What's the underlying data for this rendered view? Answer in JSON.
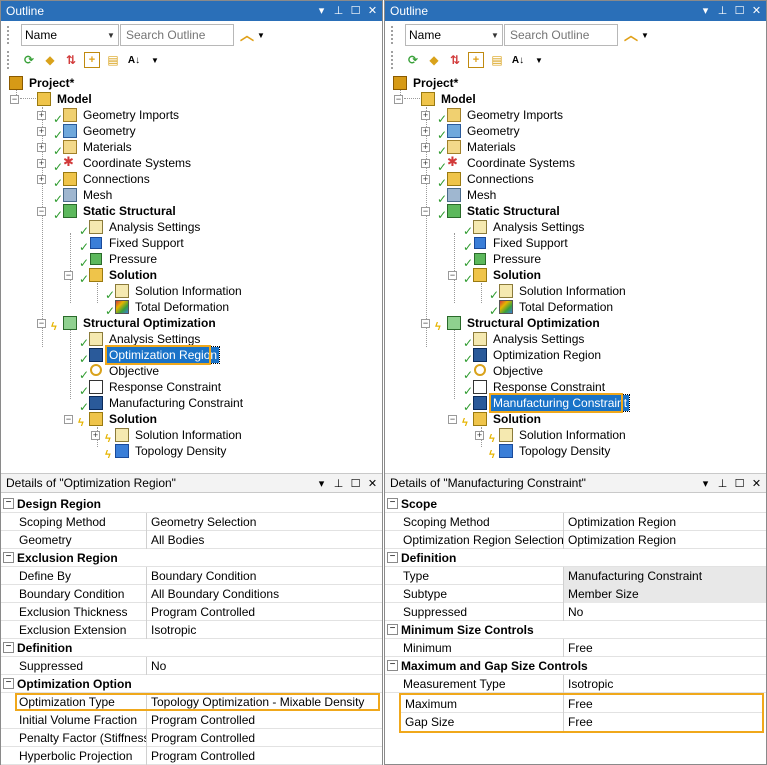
{
  "left": {
    "outline_title": "Outline",
    "sort_value": "Name",
    "search_placeholder": "Search Outline",
    "tree": {
      "project": "Project*",
      "model": "Model",
      "geometry_imports": "Geometry Imports",
      "geometry": "Geometry",
      "materials": "Materials",
      "coordinate_systems": "Coordinate Systems",
      "connections": "Connections",
      "mesh": "Mesh",
      "static_structural": "Static Structural",
      "ss_analysis_settings": "Analysis Settings",
      "fixed_support": "Fixed Support",
      "pressure": "Pressure",
      "ss_solution": "Solution",
      "ss_solution_information": "Solution Information",
      "total_deformation": "Total Deformation",
      "structural_optimization": "Structural Optimization",
      "so_analysis_settings": "Analysis Settings",
      "optimization_region": "Optimization Region",
      "objective": "Objective",
      "response_constraint": "Response Constraint",
      "manufacturing_constraint": "Manufacturing Constraint",
      "so_solution": "Solution",
      "so_solution_information": "Solution Information",
      "topology_density": "Topology Density"
    },
    "details_title": "Details of \"Optimization Region\"",
    "details": {
      "design_region": "Design Region",
      "scoping_method_k": "Scoping Method",
      "scoping_method_v": "Geometry Selection",
      "geometry_k": "Geometry",
      "geometry_v": "All Bodies",
      "exclusion_region": "Exclusion Region",
      "define_by_k": "Define By",
      "define_by_v": "Boundary Condition",
      "boundary_condition_k": "Boundary Condition",
      "boundary_condition_v": "All Boundary Conditions",
      "exclusion_thickness_k": "Exclusion Thickness",
      "exclusion_thickness_v": "Program Controlled",
      "exclusion_extension_k": "Exclusion Extension",
      "exclusion_extension_v": "Isotropic",
      "definition": "Definition",
      "suppressed_k": "Suppressed",
      "suppressed_v": "No",
      "optimization_option": "Optimization Option",
      "optimization_type_k": "Optimization Type",
      "optimization_type_v": "Topology Optimization - Mixable Density",
      "initial_volume_fraction_k": "Initial Volume Fraction",
      "initial_volume_fraction_v": "Program Controlled",
      "penalty_factor_k": "Penalty Factor (Stiffness)",
      "penalty_factor_v": "Program Controlled",
      "hyperbolic_projection_k": "Hyperbolic Projection",
      "hyperbolic_projection_v": "Program Controlled"
    }
  },
  "right": {
    "outline_title": "Outline",
    "sort_value": "Name",
    "search_placeholder": "Search Outline",
    "tree": {
      "project": "Project*",
      "model": "Model",
      "geometry_imports": "Geometry Imports",
      "geometry": "Geometry",
      "materials": "Materials",
      "coordinate_systems": "Coordinate Systems",
      "connections": "Connections",
      "mesh": "Mesh",
      "static_structural": "Static Structural",
      "ss_analysis_settings": "Analysis Settings",
      "fixed_support": "Fixed Support",
      "pressure": "Pressure",
      "ss_solution": "Solution",
      "ss_solution_information": "Solution Information",
      "total_deformation": "Total Deformation",
      "structural_optimization": "Structural Optimization",
      "so_analysis_settings": "Analysis Settings",
      "optimization_region": "Optimization Region",
      "objective": "Objective",
      "response_constraint": "Response Constraint",
      "manufacturing_constraint": "Manufacturing Constraint",
      "so_solution": "Solution",
      "so_solution_information": "Solution Information",
      "topology_density": "Topology Density"
    },
    "details_title": "Details of \"Manufacturing Constraint\"",
    "details": {
      "scope": "Scope",
      "scoping_method_k": "Scoping Method",
      "scoping_method_v": "Optimization Region",
      "optimization_region_selection_k": "Optimization Region Selection",
      "optimization_region_selection_v": "Optimization Region",
      "definition": "Definition",
      "type_k": "Type",
      "type_v": "Manufacturing Constraint",
      "subtype_k": "Subtype",
      "subtype_v": "Member Size",
      "suppressed_k": "Suppressed",
      "suppressed_v": "No",
      "minimum_size_controls": "Minimum Size Controls",
      "minimum_k": "Minimum",
      "minimum_v": "Free",
      "max_gap_controls": "Maximum and Gap Size Controls",
      "measurement_type_k": "Measurement Type",
      "measurement_type_v": "Isotropic",
      "maximum_k": "Maximum",
      "maximum_v": "Free",
      "gap_size_k": "Gap Size",
      "gap_size_v": "Free"
    }
  },
  "colors": {
    "title_bar": "#2a6fb8",
    "selection": "#1a73c8",
    "highlight": "#f0a81b",
    "check": "#2e9b2e",
    "bolt": "#e6b400"
  },
  "icons": {
    "pin": "pin-icon",
    "maximize": "maximize-icon",
    "close": "close-icon",
    "refresh": "refresh-icon",
    "eraser": "eraser-icon",
    "sort": "sort-icon"
  }
}
